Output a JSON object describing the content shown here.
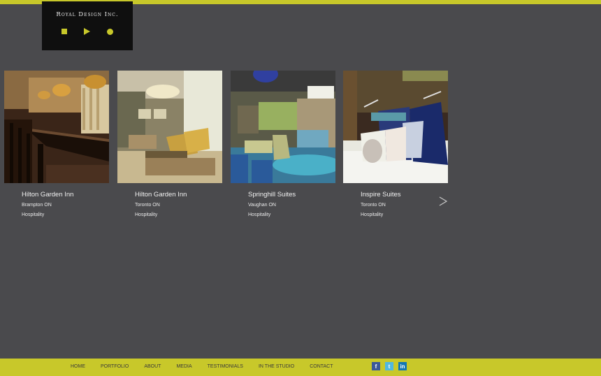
{
  "brand": {
    "name": "Royal Design Inc.",
    "accent_color": "#c8c82a",
    "logo_shapes": [
      "square-icon",
      "triangle-icon",
      "circle-icon"
    ]
  },
  "projects": [
    {
      "title": "Hilton Garden Inn",
      "location": "Brampton ON",
      "category": "Hospitality",
      "image": "dining-room-photo"
    },
    {
      "title": "Hilton Garden Inn",
      "location": "Toronto ON",
      "category": "Hospitality",
      "image": "lounge-photo"
    },
    {
      "title": "Springhill Suites",
      "location": "Vaughan ON",
      "category": "Hospitality",
      "image": "lobby-photo"
    },
    {
      "title": "Inspire Suites",
      "location": "Toronto ON",
      "category": "Hospitality",
      "image": "bedroom-photo"
    }
  ],
  "carousel": {
    "next_icon": "chevron-right-icon"
  },
  "footer": {
    "nav": [
      "HOME",
      "PORTFOLIO",
      "ABOUT",
      "MEDIA",
      "TESTIMONIALS",
      "IN THE STUDIO",
      "CONTACT"
    ],
    "social": [
      {
        "label": "f",
        "icon": "facebook-icon"
      },
      {
        "label": "t",
        "icon": "twitter-icon"
      },
      {
        "label": "in",
        "icon": "linkedin-icon"
      }
    ]
  }
}
